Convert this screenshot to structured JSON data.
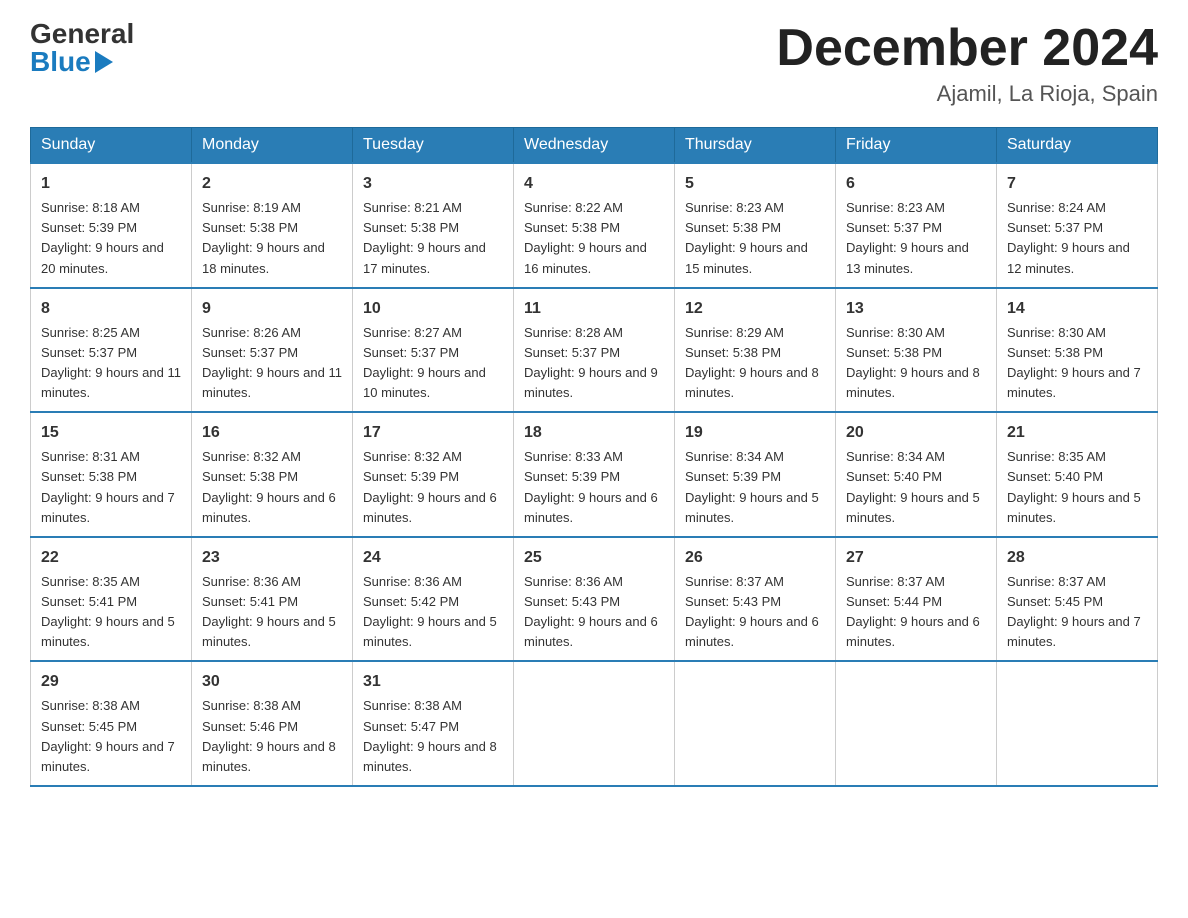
{
  "logo": {
    "general": "General",
    "blue": "Blue"
  },
  "header": {
    "month": "December 2024",
    "location": "Ajamil, La Rioja, Spain"
  },
  "weekdays": [
    "Sunday",
    "Monday",
    "Tuesday",
    "Wednesday",
    "Thursday",
    "Friday",
    "Saturday"
  ],
  "weeks": [
    [
      {
        "day": "1",
        "sunrise": "8:18 AM",
        "sunset": "5:39 PM",
        "daylight": "9 hours and 20 minutes."
      },
      {
        "day": "2",
        "sunrise": "8:19 AM",
        "sunset": "5:38 PM",
        "daylight": "9 hours and 18 minutes."
      },
      {
        "day": "3",
        "sunrise": "8:21 AM",
        "sunset": "5:38 PM",
        "daylight": "9 hours and 17 minutes."
      },
      {
        "day": "4",
        "sunrise": "8:22 AM",
        "sunset": "5:38 PM",
        "daylight": "9 hours and 16 minutes."
      },
      {
        "day": "5",
        "sunrise": "8:23 AM",
        "sunset": "5:38 PM",
        "daylight": "9 hours and 15 minutes."
      },
      {
        "day": "6",
        "sunrise": "8:23 AM",
        "sunset": "5:37 PM",
        "daylight": "9 hours and 13 minutes."
      },
      {
        "day": "7",
        "sunrise": "8:24 AM",
        "sunset": "5:37 PM",
        "daylight": "9 hours and 12 minutes."
      }
    ],
    [
      {
        "day": "8",
        "sunrise": "8:25 AM",
        "sunset": "5:37 PM",
        "daylight": "9 hours and 11 minutes."
      },
      {
        "day": "9",
        "sunrise": "8:26 AM",
        "sunset": "5:37 PM",
        "daylight": "9 hours and 11 minutes."
      },
      {
        "day": "10",
        "sunrise": "8:27 AM",
        "sunset": "5:37 PM",
        "daylight": "9 hours and 10 minutes."
      },
      {
        "day": "11",
        "sunrise": "8:28 AM",
        "sunset": "5:37 PM",
        "daylight": "9 hours and 9 minutes."
      },
      {
        "day": "12",
        "sunrise": "8:29 AM",
        "sunset": "5:38 PM",
        "daylight": "9 hours and 8 minutes."
      },
      {
        "day": "13",
        "sunrise": "8:30 AM",
        "sunset": "5:38 PM",
        "daylight": "9 hours and 8 minutes."
      },
      {
        "day": "14",
        "sunrise": "8:30 AM",
        "sunset": "5:38 PM",
        "daylight": "9 hours and 7 minutes."
      }
    ],
    [
      {
        "day": "15",
        "sunrise": "8:31 AM",
        "sunset": "5:38 PM",
        "daylight": "9 hours and 7 minutes."
      },
      {
        "day": "16",
        "sunrise": "8:32 AM",
        "sunset": "5:38 PM",
        "daylight": "9 hours and 6 minutes."
      },
      {
        "day": "17",
        "sunrise": "8:32 AM",
        "sunset": "5:39 PM",
        "daylight": "9 hours and 6 minutes."
      },
      {
        "day": "18",
        "sunrise": "8:33 AM",
        "sunset": "5:39 PM",
        "daylight": "9 hours and 6 minutes."
      },
      {
        "day": "19",
        "sunrise": "8:34 AM",
        "sunset": "5:39 PM",
        "daylight": "9 hours and 5 minutes."
      },
      {
        "day": "20",
        "sunrise": "8:34 AM",
        "sunset": "5:40 PM",
        "daylight": "9 hours and 5 minutes."
      },
      {
        "day": "21",
        "sunrise": "8:35 AM",
        "sunset": "5:40 PM",
        "daylight": "9 hours and 5 minutes."
      }
    ],
    [
      {
        "day": "22",
        "sunrise": "8:35 AM",
        "sunset": "5:41 PM",
        "daylight": "9 hours and 5 minutes."
      },
      {
        "day": "23",
        "sunrise": "8:36 AM",
        "sunset": "5:41 PM",
        "daylight": "9 hours and 5 minutes."
      },
      {
        "day": "24",
        "sunrise": "8:36 AM",
        "sunset": "5:42 PM",
        "daylight": "9 hours and 5 minutes."
      },
      {
        "day": "25",
        "sunrise": "8:36 AM",
        "sunset": "5:43 PM",
        "daylight": "9 hours and 6 minutes."
      },
      {
        "day": "26",
        "sunrise": "8:37 AM",
        "sunset": "5:43 PM",
        "daylight": "9 hours and 6 minutes."
      },
      {
        "day": "27",
        "sunrise": "8:37 AM",
        "sunset": "5:44 PM",
        "daylight": "9 hours and 6 minutes."
      },
      {
        "day": "28",
        "sunrise": "8:37 AM",
        "sunset": "5:45 PM",
        "daylight": "9 hours and 7 minutes."
      }
    ],
    [
      {
        "day": "29",
        "sunrise": "8:38 AM",
        "sunset": "5:45 PM",
        "daylight": "9 hours and 7 minutes."
      },
      {
        "day": "30",
        "sunrise": "8:38 AM",
        "sunset": "5:46 PM",
        "daylight": "9 hours and 8 minutes."
      },
      {
        "day": "31",
        "sunrise": "8:38 AM",
        "sunset": "5:47 PM",
        "daylight": "9 hours and 8 minutes."
      },
      null,
      null,
      null,
      null
    ]
  ]
}
